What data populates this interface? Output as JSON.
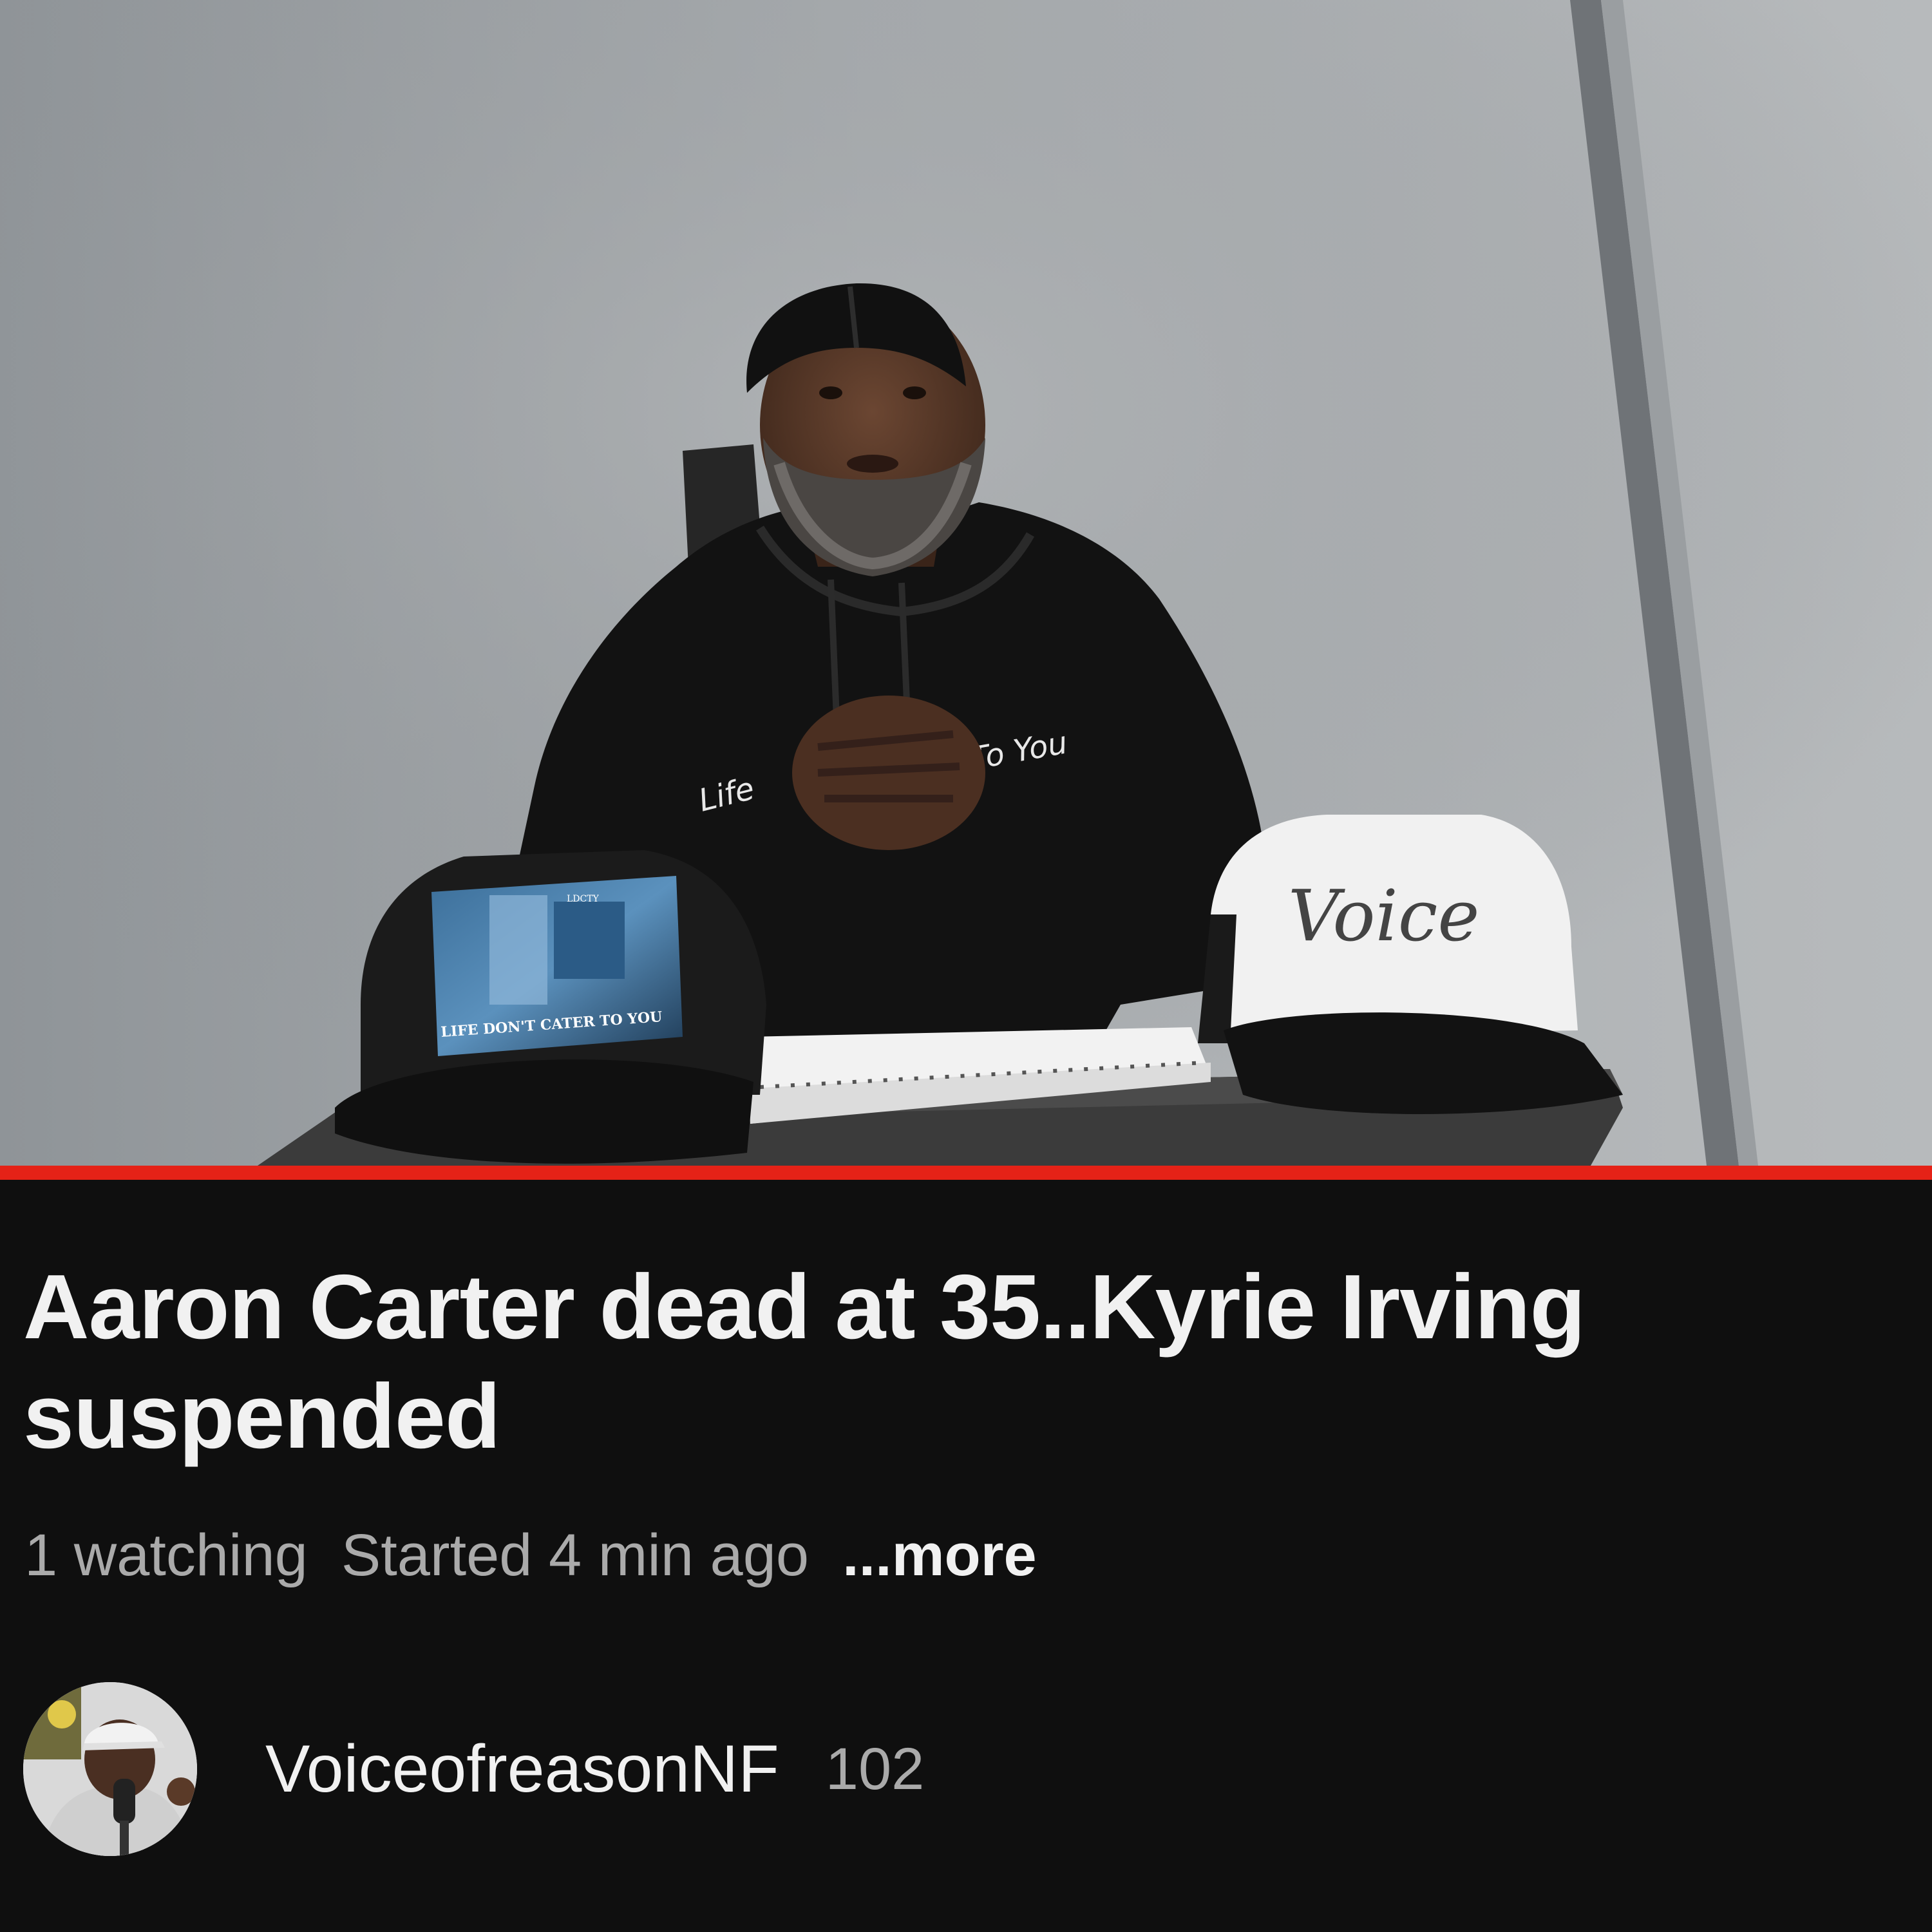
{
  "video": {
    "progress_fraction": 1.0,
    "scene": {
      "hoodie_text_left": "Life",
      "hoodie_text_right": "To You",
      "cap_left_text": "LIFE DON'T CATER TO YOU",
      "cap_left_badge": "LDCTY",
      "cap_right_text": "Voice"
    }
  },
  "info": {
    "title": "Aaron Carter dead at 35..Kyrie Irving suspended",
    "watching": "1 watching",
    "started": "Started 4 min ago",
    "more_label": "...more"
  },
  "channel": {
    "name": "VoiceofreasonNF",
    "subscriber_count": "102"
  },
  "colors": {
    "background": "#0f0f0f",
    "progress_red": "#e52217",
    "text_primary": "#f1f1f1",
    "text_secondary": "#aaaaaa"
  }
}
